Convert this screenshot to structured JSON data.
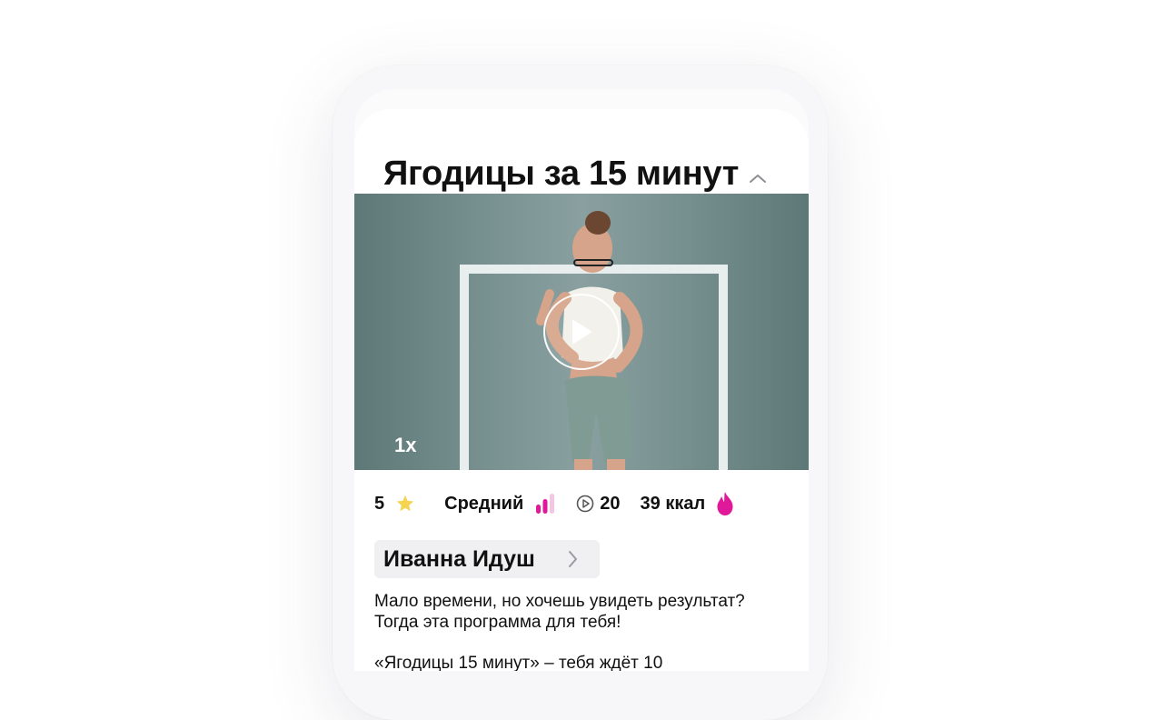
{
  "header": {
    "title": "Ягодицы за 15 минут",
    "collapse_icon": "chevron-up-icon"
  },
  "video": {
    "speed_label": "1x",
    "play_icon": "play-icon"
  },
  "stats": {
    "rating": "5",
    "rating_icon": "star-icon",
    "level": "Средний",
    "level_icon": "difficulty-bars-icon",
    "views": "20",
    "views_icon": "play-circle-icon",
    "calories": "39 ккал",
    "calories_icon": "flame-icon"
  },
  "trainer": {
    "name": "Иванна Идуш",
    "chevron_icon": "chevron-right-icon"
  },
  "description": {
    "line1": "Мало времени, но хочешь увидеть результат?",
    "line2": "Тогда эта программа для тебя!",
    "line3": "«Ягодицы 15 минут» – тебя ждёт 10"
  },
  "colors": {
    "accent_pink": "#e0199a",
    "star_yellow": "#f5d451",
    "video_bg": "#7a9393"
  }
}
